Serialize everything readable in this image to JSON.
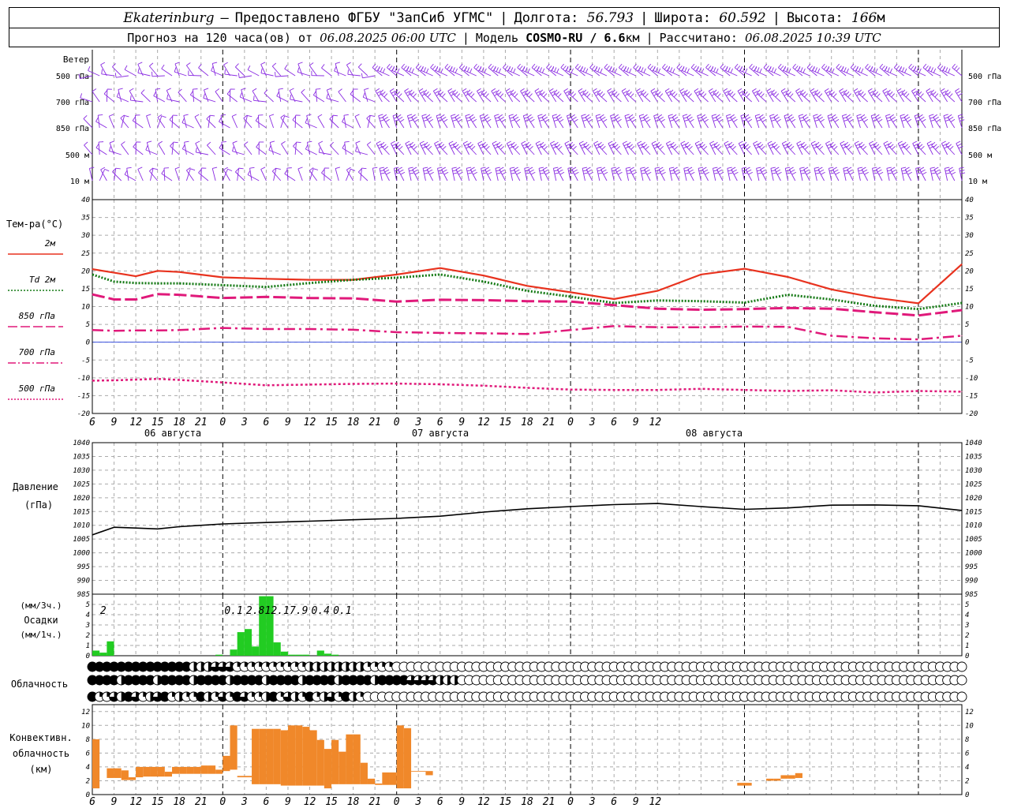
{
  "header": {
    "city": "Ekaterinburg",
    "provider": "Предоставлено ФГБУ \"ЗапСиб УГМС\"",
    "lon_label": "Долгота:",
    "lon": "56.793",
    "lat_label": "Широта:",
    "lat": "60.592",
    "alt_label": "Высота:",
    "alt": "166",
    "alt_unit": "м",
    "forecast_text": "Прогноз на 120 часа(ов) от",
    "forecast_start": "06.08.2025 06:00 UTC",
    "model_label": "Модель",
    "model": "COSMO-RU / 6.6",
    "model_unit": "км",
    "computed_label": "Рассчитано:",
    "computed": "06.08.2025 10:39 UTC"
  },
  "wind_panel": {
    "title": "Ветер",
    "levels": [
      "500 гПа",
      "700 гПа",
      "850 гПа",
      "500 м",
      "10 м"
    ]
  },
  "time_axis": {
    "hour_labels": [
      "6",
      "9",
      "12",
      "15",
      "18",
      "21",
      "0",
      "3",
      "6",
      "9",
      "12",
      "15",
      "18",
      "21",
      "0",
      "3",
      "6",
      "9",
      "12",
      "15",
      "18",
      "21",
      "0",
      "3",
      "6",
      "9",
      "12"
    ],
    "date_labels": [
      "06 августа",
      "07 августа",
      "08 августа"
    ]
  },
  "temp_panel": {
    "title": "Тем-ра(°C)",
    "legend": [
      {
        "label": "2м",
        "color": "#e8321e",
        "dash": "solid"
      },
      {
        "label": "Td 2м",
        "color": "#157a15",
        "dash": "dotted"
      },
      {
        "label": "850 гПа",
        "color": "#e0197a",
        "dash": "long-dash"
      },
      {
        "label": "700 гПа",
        "color": "#e0197a",
        "dash": "dash-dot"
      },
      {
        "label": "500 гПа",
        "color": "#e0197a",
        "dash": "dotted"
      }
    ],
    "ticks": [
      40,
      35,
      30,
      25,
      20,
      15,
      10,
      5,
      0,
      -5,
      -10,
      -15,
      -20
    ]
  },
  "pressure_panel": {
    "title": "Давление",
    "unit": "(гПа)",
    "ticks": [
      1040,
      1035,
      1030,
      1025,
      1020,
      1015,
      1010,
      1005,
      1000,
      995,
      990,
      985
    ]
  },
  "precip_panel": {
    "title_top": "(мм/3ч.)",
    "title": "Осадки",
    "title_bottom": "(мм/1ч.)",
    "ticks": [
      5,
      4,
      3,
      2,
      1,
      0
    ],
    "totals": [
      "2",
      "0.1",
      "2.8",
      "12.1",
      "7.9",
      "0.4",
      "0.1"
    ]
  },
  "cloud_panel": {
    "title": "Облачность"
  },
  "convective_panel": {
    "title_lines": [
      "Конвективн.",
      "облачность",
      "(км)"
    ],
    "ticks": [
      12,
      10,
      8,
      6,
      4,
      2,
      0
    ]
  },
  "colors": {
    "wind": "#8a2be2",
    "temp_2m": "#e8321e",
    "dewpoint": "#157a15",
    "upper_air": "#e0197a",
    "zero_line": "#3a50e0",
    "pressure": "#000000",
    "precip": "#22cc22",
    "convective": "#f0882a"
  },
  "chart_data": [
    {
      "type": "line",
      "x_unit": "hours since 06.08.2025 06:00 UTC",
      "ylim": [
        -20,
        40
      ],
      "series": [
        {
          "name": "2м",
          "x": [
            0,
            3,
            6,
            9,
            12,
            18,
            24,
            30,
            36,
            42,
            48,
            54,
            60,
            66,
            72,
            78,
            84,
            90,
            96,
            102,
            108,
            114,
            120
          ],
          "values": [
            20.5,
            19.5,
            18.5,
            20,
            19.7,
            18.2,
            17.8,
            17.5,
            17.5,
            19,
            20.8,
            18.7,
            15.8,
            14,
            12.1,
            14.4,
            19,
            20.6,
            18.3,
            14.8,
            12.5,
            10.9,
            21.9
          ]
        },
        {
          "name": "Td 2м",
          "x": [
            0,
            3,
            6,
            9,
            12,
            18,
            24,
            30,
            36,
            42,
            48,
            54,
            60,
            66,
            72,
            78,
            84,
            90,
            96,
            102,
            108,
            114,
            120
          ],
          "values": [
            19,
            17,
            16.6,
            16.5,
            16.5,
            16,
            15.5,
            16.6,
            17.5,
            18.1,
            19,
            17,
            14.4,
            12.8,
            11,
            11.7,
            11.5,
            11.1,
            13.3,
            12,
            10.2,
            9.3,
            11
          ]
        },
        {
          "name": "850 гПа",
          "x": [
            0,
            3,
            6,
            9,
            12,
            18,
            24,
            30,
            36,
            42,
            48,
            54,
            60,
            66,
            72,
            78,
            84,
            90,
            96,
            102,
            108,
            114,
            120
          ],
          "values": [
            13.4,
            12,
            12,
            13.5,
            13.3,
            12.4,
            12.7,
            12.4,
            12.3,
            11.4,
            11.9,
            11.8,
            11.5,
            11.4,
            10.4,
            9.4,
            9.1,
            9.3,
            9.6,
            9.4,
            8.4,
            7.5,
            9
          ]
        },
        {
          "name": "700 гПа",
          "x": [
            0,
            3,
            6,
            9,
            12,
            18,
            24,
            30,
            36,
            42,
            48,
            54,
            60,
            66,
            72,
            78,
            84,
            90,
            96,
            102,
            108,
            114,
            120
          ],
          "values": [
            3.4,
            3.2,
            3.3,
            3.3,
            3.4,
            4,
            3.7,
            3.7,
            3.5,
            2.8,
            2.6,
            2.5,
            2.3,
            3.4,
            4.5,
            4.2,
            4.2,
            4.4,
            4.3,
            1.8,
            1.1,
            0.8,
            1.8
          ]
        },
        {
          "name": "500 гПа",
          "x": [
            0,
            3,
            6,
            9,
            12,
            18,
            24,
            30,
            36,
            42,
            48,
            54,
            60,
            66,
            72,
            78,
            84,
            90,
            96,
            102,
            108,
            114,
            120
          ],
          "values": [
            -10.8,
            -10.7,
            -10.5,
            -10.3,
            -10.6,
            -11.3,
            -12.1,
            -11.9,
            -11.7,
            -11.6,
            -11.8,
            -12.2,
            -12.8,
            -13.3,
            -13.4,
            -13.4,
            -13.1,
            -13.4,
            -13.7,
            -13.5,
            -14.1,
            -13.7,
            -13.9
          ]
        }
      ]
    },
    {
      "type": "line",
      "x_unit": "hours since 06.08.2025 06:00 UTC",
      "ylim": [
        985,
        1040
      ],
      "series": [
        {
          "name": "Давление",
          "x": [
            0,
            3,
            6,
            9,
            12,
            18,
            24,
            30,
            36,
            42,
            48,
            54,
            60,
            66,
            72,
            78,
            84,
            90,
            96,
            102,
            108,
            114,
            120
          ],
          "values": [
            1006.5,
            1009.3,
            1009,
            1008.7,
            1009.5,
            1010.5,
            1011,
            1011.5,
            1012,
            1012.5,
            1013.3,
            1014.8,
            1016,
            1016.8,
            1017.5,
            1017.9,
            1016.8,
            1015.8,
            1016.3,
            1017.3,
            1017.4,
            1017.1,
            1015.4
          ]
        }
      ]
    },
    {
      "type": "bar",
      "x_unit": "hours since 06.08.2025 06:00 UTC",
      "ylim": [
        0,
        6
      ],
      "x": [
        0,
        1,
        2,
        17,
        19,
        20,
        21,
        22,
        23,
        24,
        25,
        26,
        27,
        28,
        29,
        31,
        32,
        33
      ],
      "values": [
        0.5,
        0.3,
        1.4,
        0.1,
        0.6,
        2.3,
        2.6,
        0.9,
        5.8,
        5.8,
        1.3,
        0.4,
        0.1,
        0.1,
        0.1,
        0.5,
        0.2,
        0.1
      ],
      "period_totals": {
        "x": [
          1.5,
          19.5,
          22.5,
          25.5,
          28.5,
          31.5,
          34.5
        ],
        "values": [
          2,
          0.1,
          2.8,
          12.1,
          7.9,
          0.4,
          0.1
        ]
      }
    },
    {
      "type": "bar",
      "x_unit": "hours since 06.08.2025 06:00 UTC",
      "ylim": [
        0,
        13
      ],
      "bars": [
        {
          "x": 0.5,
          "base": 0.9,
          "top": 8
        },
        {
          "x": 2.5,
          "base": 2.4,
          "top": 3.8
        },
        {
          "x": 3.5,
          "base": 2.4,
          "top": 3.8
        },
        {
          "x": 4.5,
          "base": 2.1,
          "top": 3.5
        },
        {
          "x": 5.5,
          "base": 2.1,
          "top": 2.5
        },
        {
          "x": 6.5,
          "base": 2.5,
          "top": 4
        },
        {
          "x": 7.5,
          "base": 2.6,
          "top": 4
        },
        {
          "x": 8.5,
          "base": 2.6,
          "top": 4
        },
        {
          "x": 9.5,
          "base": 2.6,
          "top": 4
        },
        {
          "x": 10.5,
          "base": 2.6,
          "top": 3.3
        },
        {
          "x": 11.5,
          "base": 3,
          "top": 4
        },
        {
          "x": 12.5,
          "base": 3,
          "top": 4
        },
        {
          "x": 13.5,
          "base": 3,
          "top": 4
        },
        {
          "x": 14.5,
          "base": 3,
          "top": 4
        },
        {
          "x": 15.5,
          "base": 3,
          "top": 4.2
        },
        {
          "x": 16.5,
          "base": 3,
          "top": 4.2
        },
        {
          "x": 17.5,
          "base": 3,
          "top": 3.6
        },
        {
          "x": 18.5,
          "base": 3.4,
          "top": 5.6
        },
        {
          "x": 19.5,
          "base": 3.6,
          "top": 10
        },
        {
          "x": 20.5,
          "base": 2.5,
          "top": 2.7
        },
        {
          "x": 21.5,
          "base": 2.5,
          "top": 2.7
        },
        {
          "x": 22.5,
          "base": 1.5,
          "top": 9.5
        },
        {
          "x": 23.5,
          "base": 1.5,
          "top": 9.5
        },
        {
          "x": 24.5,
          "base": 1.5,
          "top": 9.5
        },
        {
          "x": 25.5,
          "base": 1.5,
          "top": 9.5
        },
        {
          "x": 26.5,
          "base": 1.3,
          "top": 9.3
        },
        {
          "x": 27.5,
          "base": 1.3,
          "top": 10
        },
        {
          "x": 28.5,
          "base": 1.3,
          "top": 10
        },
        {
          "x": 29.5,
          "base": 1.3,
          "top": 9.8
        },
        {
          "x": 30.5,
          "base": 1.3,
          "top": 9.3
        },
        {
          "x": 31.5,
          "base": 1.3,
          "top": 7.9
        },
        {
          "x": 32.5,
          "base": 0.9,
          "top": 6.6
        },
        {
          "x": 33.5,
          "base": 1.5,
          "top": 7.9
        },
        {
          "x": 34.5,
          "base": 1.5,
          "top": 6.2
        },
        {
          "x": 35.5,
          "base": 1.5,
          "top": 8.7
        },
        {
          "x": 36.5,
          "base": 1.5,
          "top": 8.7
        },
        {
          "x": 37.5,
          "base": 1.5,
          "top": 4.6
        },
        {
          "x": 38.5,
          "base": 1.5,
          "top": 2.3
        },
        {
          "x": 39.5,
          "base": 1.4,
          "top": 1.6
        },
        {
          "x": 40.5,
          "base": 1.4,
          "top": 3.2
        },
        {
          "x": 41.5,
          "base": 1.4,
          "top": 3.2
        },
        {
          "x": 42.5,
          "base": 0.9,
          "top": 10
        },
        {
          "x": 43.5,
          "base": 0.9,
          "top": 9.6
        },
        {
          "x": 44.5,
          "base": 3.3,
          "top": 3.4
        },
        {
          "x": 45.5,
          "base": 3.3,
          "top": 3.4
        },
        {
          "x": 46.5,
          "base": 2.8,
          "top": 3.4
        },
        {
          "x": 89.5,
          "base": 1.3,
          "top": 1.7
        },
        {
          "x": 90.5,
          "base": 1.3,
          "top": 1.7
        },
        {
          "x": 93.5,
          "base": 2,
          "top": 2.3
        },
        {
          "x": 94.5,
          "base": 2,
          "top": 2.3
        },
        {
          "x": 95.5,
          "base": 2.3,
          "top": 2.8
        },
        {
          "x": 96.5,
          "base": 2.3,
          "top": 2.8
        },
        {
          "x": 97.5,
          "base": 2.4,
          "top": 3.1
        }
      ]
    }
  ]
}
